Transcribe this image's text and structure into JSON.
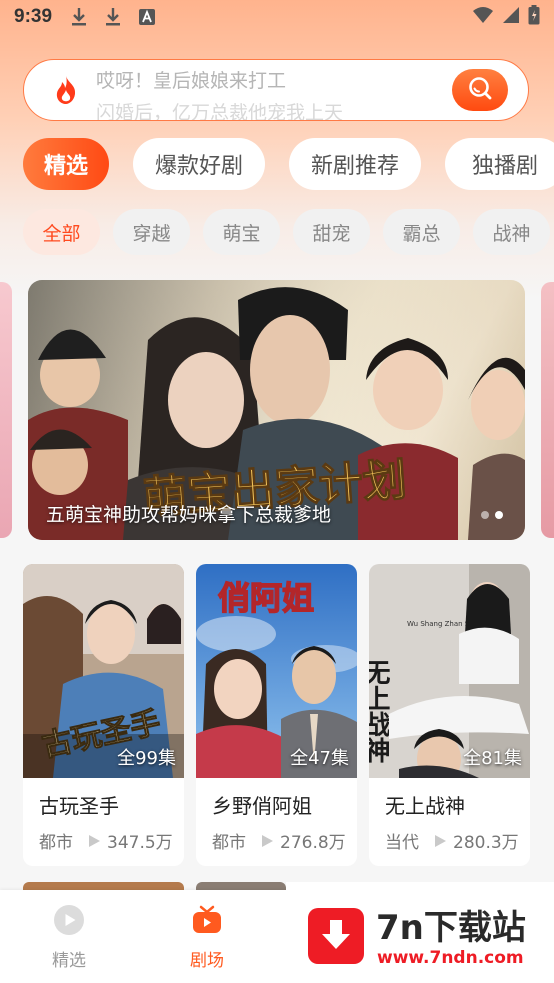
{
  "status_bar": {
    "time": "9:39"
  },
  "search": {
    "placeholder_primary": "哎呀！皇后娘娘来打工",
    "placeholder_next": "闪婚后，亿万总裁他宠我上天"
  },
  "tabs": [
    {
      "label": "精选",
      "active": true
    },
    {
      "label": "爆款好剧",
      "active": false
    },
    {
      "label": "新剧推荐",
      "active": false
    },
    {
      "label": "独播剧",
      "active": false
    }
  ],
  "chips": [
    {
      "label": "全部",
      "active": true
    },
    {
      "label": "穿越",
      "active": false
    },
    {
      "label": "萌宝",
      "active": false
    },
    {
      "label": "甜宠",
      "active": false
    },
    {
      "label": "霸总",
      "active": false
    },
    {
      "label": "战神",
      "active": false
    }
  ],
  "banner": {
    "caption": "五萌宝神助攻帮妈咪拿下总裁爹地",
    "poster_title": "萌宝出家计划",
    "slide_count": 2,
    "active_slide": 2
  },
  "cards": [
    {
      "title": "古玩圣手",
      "episodes": "全99集",
      "genre": "都市",
      "plays": "347.5万",
      "poster_text": "古玩圣手",
      "accent": "#7a5a3a"
    },
    {
      "title": "乡野俏阿姐",
      "episodes": "全47集",
      "genre": "都市",
      "plays": "276.8万",
      "poster_text": "俏阿姐",
      "accent": "#3c7fd0"
    },
    {
      "title": "无上战神",
      "episodes": "全81集",
      "genre": "当代",
      "plays": "280.3万",
      "poster_text": "无上战神",
      "poster_sub": "Wu Shang Zhan Shen",
      "accent": "#cfcac4"
    }
  ],
  "bottom_nav": [
    {
      "label": "精选",
      "active": false,
      "icon": "play-circle-icon"
    },
    {
      "label": "剧场",
      "active": true,
      "icon": "tv-icon"
    }
  ],
  "watermark": {
    "title": "7n下载站",
    "url": "www.7ndn.com"
  },
  "colors": {
    "accent": "#ff5a1f",
    "accent_light": "#ff7b3d"
  }
}
